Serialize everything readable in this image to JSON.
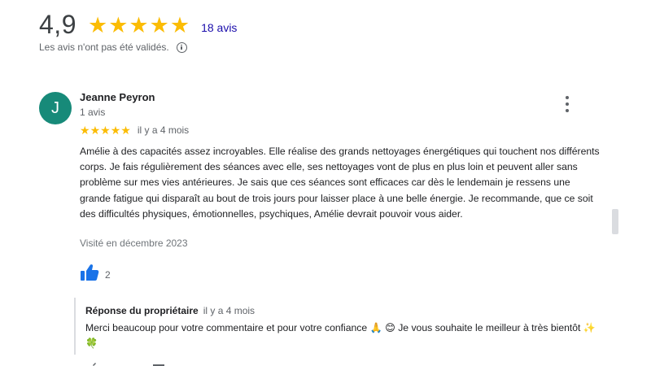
{
  "summary": {
    "rating": "4,9",
    "stars_filled": 5,
    "count_label": "18 avis",
    "unverified_note": "Les avis n'ont pas été validés."
  },
  "review": {
    "avatar_initial": "J",
    "avatar_color": "#178a79",
    "reviewer_name": "Jeanne Peyron",
    "reviewer_review_count": "1 avis",
    "stars": 5,
    "time_ago": "il y a 4 mois",
    "text": "Amélie à des capacités assez incroyables. Elle réalise des grands nettoyages énergétiques qui touchent nos différents corps. Je fais régulièrement des séances avec elle, ses nettoyages vont de plus en plus loin et peuvent aller sans problème sur mes vies antérieures. Je sais que ces séances sont efficaces car dès le lendemain je ressens une grande fatigue qui disparaît au bout de trois jours pour laisser place à une belle énergie. Je recommande, que ce soit des difficultés physiques, émotionnelles, psychiques, Amélie devrait pouvoir vous aider.",
    "visited": "Visité en décembre 2023",
    "likes": "2"
  },
  "owner_reply": {
    "title": "Réponse du propriétaire",
    "time_ago": "il y a 4 mois",
    "text": "Merci beaucoup pour votre commentaire et pour votre confiance 🙏 😊 Je vous souhaite le meilleur à très bientôt ✨ 🍀"
  },
  "colors": {
    "star": "#fbbc04",
    "link": "#1a0dab",
    "like_icon": "#1a73e8"
  }
}
